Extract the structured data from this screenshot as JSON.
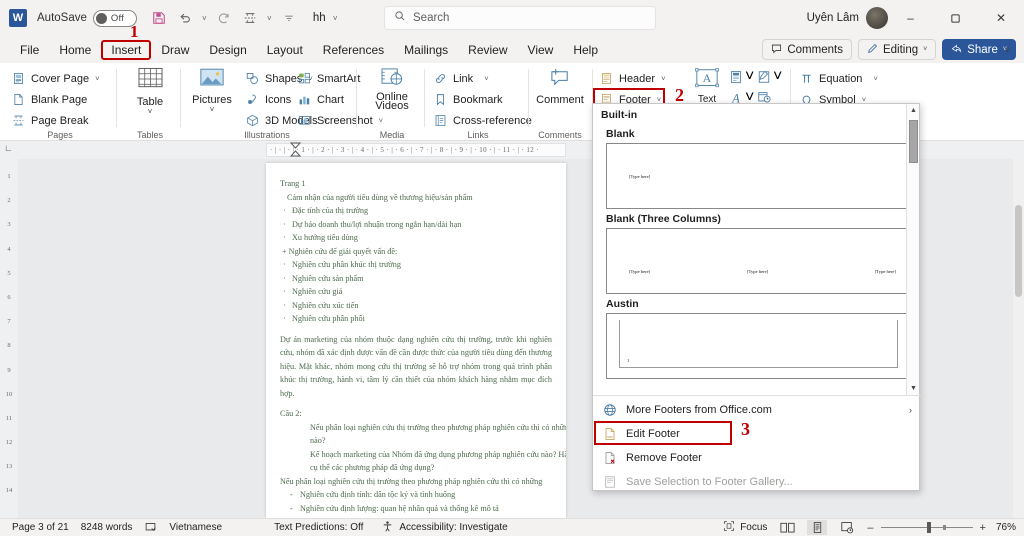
{
  "titlebar": {
    "app_logo": "word-logo",
    "autosave_label": "AutoSave",
    "autosave_state": "Off",
    "document_name": "hh",
    "user_name": "Uyên Lâm",
    "minimize": "–",
    "restore": "❐",
    "close": "✕"
  },
  "search": {
    "placeholder": "Search"
  },
  "tabs": [
    {
      "label": "File",
      "marked": false
    },
    {
      "label": "Home",
      "marked": false
    },
    {
      "label": "Insert",
      "marked": true
    },
    {
      "label": "Draw",
      "marked": false
    },
    {
      "label": "Design",
      "marked": false
    },
    {
      "label": "Layout",
      "marked": false
    },
    {
      "label": "References",
      "marked": false
    },
    {
      "label": "Mailings",
      "marked": false
    },
    {
      "label": "Review",
      "marked": false
    },
    {
      "label": "View",
      "marked": false
    },
    {
      "label": "Help",
      "marked": false
    }
  ],
  "tab_right": {
    "comments": "Comments",
    "editing": "Editing",
    "share": "Share"
  },
  "markers": {
    "one": "1",
    "two": "2",
    "three": "3",
    "color": "#c00000"
  },
  "ribbon": {
    "groups": [
      {
        "name": "Pages",
        "label": "Pages",
        "items": [
          {
            "label": "Cover Page",
            "icon": "cover-page-icon",
            "caret": true
          },
          {
            "label": "Blank Page",
            "icon": "blank-page-icon",
            "caret": false
          },
          {
            "label": "Page Break",
            "icon": "page-break-icon",
            "caret": false
          }
        ]
      },
      {
        "name": "Tables",
        "label": "Tables",
        "items": [
          {
            "label": "Table",
            "icon": "table-icon",
            "caret": true
          }
        ]
      },
      {
        "name": "Illustrations",
        "label": "Illustrations",
        "items": [
          {
            "label": "Pictures",
            "icon": "pictures-icon",
            "caret": true
          },
          {
            "label": "Shapes",
            "icon": "shapes-icon",
            "caret": true
          },
          {
            "label": "Icons",
            "icon": "icons-icon",
            "caret": false
          },
          {
            "label": "3D Models",
            "icon": "3d-models-icon",
            "caret": true
          },
          {
            "label": "SmartArt",
            "icon": "smartart-icon",
            "caret": false
          },
          {
            "label": "Chart",
            "icon": "chart-icon",
            "caret": false
          },
          {
            "label": "Screenshot",
            "icon": "screenshot-icon",
            "caret": true
          }
        ]
      },
      {
        "name": "Media",
        "label": "Media",
        "items": [
          {
            "label": "Online Videos",
            "icon": "online-videos-icon",
            "caret": false
          }
        ]
      },
      {
        "name": "Links",
        "label": "Links",
        "items": [
          {
            "label": "Link",
            "icon": "link-icon",
            "caret": true
          },
          {
            "label": "Bookmark",
            "icon": "bookmark-icon",
            "caret": false
          },
          {
            "label": "Cross-reference",
            "icon": "cross-reference-icon",
            "caret": false
          }
        ]
      },
      {
        "name": "Comments",
        "label": "Comments",
        "items": [
          {
            "label": "Comment",
            "icon": "comment-icon",
            "caret": false
          }
        ]
      },
      {
        "name": "HeaderFooter",
        "label": "",
        "items": [
          {
            "label": "Header",
            "icon": "header-icon",
            "caret": true
          },
          {
            "label": "Footer",
            "icon": "footer-icon",
            "caret": true
          }
        ]
      },
      {
        "name": "Text",
        "label": "",
        "items": [
          {
            "label": "Text",
            "icon": "text-box-icon",
            "caret": false
          }
        ]
      },
      {
        "name": "Symbols",
        "label": "",
        "items": [
          {
            "label": "Equation",
            "icon": "equation-icon",
            "caret": true
          },
          {
            "label": "Symbol",
            "icon": "symbol-icon",
            "caret": true
          }
        ]
      }
    ]
  },
  "footer_dropdown": {
    "category": "Built-in",
    "gallery": [
      {
        "name": "Blank",
        "type": "blank",
        "placeholders": [
          "[Type here]"
        ]
      },
      {
        "name": "Blank (Three Columns)",
        "type": "three-columns",
        "placeholders": [
          "[Type here]",
          "[Type here]",
          "[Type here]"
        ]
      },
      {
        "name": "Austin",
        "type": "austin",
        "placeholders": [
          "1"
        ]
      }
    ],
    "commands": [
      {
        "label": "More Footers from Office.com",
        "icon": "globe-icon",
        "accel": "M",
        "disabled": false,
        "submenu": true,
        "marked": false
      },
      {
        "label": "Edit Footer",
        "icon": "edit-footer-icon",
        "accel": "E",
        "disabled": false,
        "submenu": false,
        "marked": true
      },
      {
        "label": "Remove Footer",
        "icon": "remove-footer-icon",
        "accel": "R",
        "disabled": false,
        "submenu": false,
        "marked": false
      },
      {
        "label": "Save Selection to Footer Gallery...",
        "icon": "save-selection-icon",
        "accel": "S",
        "disabled": true,
        "submenu": false,
        "marked": false
      }
    ]
  },
  "ruler": {
    "horizontal_ticks": "· | · | ·    | · 1 · | · 2 · | · 3 · | · 4 · | · 5 · | · 6 · | · 7 · | · 8 · | · 9 · | · 10 · | · 11 · | · 12 ·",
    "vertical_ticks": [
      "1",
      "2",
      "3",
      "4",
      "5",
      "6",
      "7",
      "8",
      "9",
      "10",
      "11",
      "12",
      "13",
      "14"
    ]
  },
  "document": {
    "page_label": "Trang 1",
    "lines": [
      {
        "text": "Cảm nhận của người tiêu dùng về thương hiệu/sản phẩm",
        "style": "indent1"
      },
      {
        "text": "Đặc tính của thị trường",
        "style": "bullet"
      },
      {
        "text": "Dự báo doanh thu/lợi nhuận trong ngắn hạn/dài hạn",
        "style": "bullet"
      },
      {
        "text": "Xu hướng tiêu dùng",
        "style": "bullet"
      },
      {
        "text": "+ Nghiên cứu để giải quyết vấn đề:",
        "style": "plus"
      },
      {
        "text": "Nghiên cứu phân khúc thị trường",
        "style": "bullet"
      },
      {
        "text": "Nghiên cứu sản phẩm",
        "style": "bullet"
      },
      {
        "text": "Nghiên cứu giá",
        "style": "bullet"
      },
      {
        "text": "Nghiên cứu xúc tiến",
        "style": "bullet"
      },
      {
        "text": "Nghiên cứu phân phối",
        "style": "bullet"
      }
    ],
    "paragraph": "Dự án marketing của nhóm thuộc dạng nghiên cứu thị trường, trước khi nghiên cứu, nhóm đã xác định được vấn đề cần được thức của người tiêu dùng đến thương hiệu. Mặt khác, nhóm mong cứu thị trường sẽ hỗ trợ nhóm trong quá trình phân khúc thị trường, hành vi, tâm lý cần thiết của nhóm khách hàng nhằm mục đích hợp.",
    "question_heading": "Câu 2:",
    "question_lines": [
      {
        "text": "Nếu phân loại nghiên cứu thị trường theo phương pháp nghiên cứu thì có những phương pháp",
        "style": "ind2"
      },
      {
        "text": "nào?",
        "style": "ind2"
      },
      {
        "text": "Kế hoạch marketing của Nhóm đã ứng dụng phương pháp nghiên cứu nào? Hãy nêu",
        "style": "ind2"
      },
      {
        "text": "cụ thể các phương pháp đã ứng dụng?",
        "style": "ind2"
      },
      {
        "text": "Nếu phân loại nghiên cứu thị trường theo phương pháp nghiên cứu thì có những",
        "style": "none"
      },
      {
        "text": "Nghiên cứu định tính: dân tộc ký và tình huống",
        "style": "dash"
      },
      {
        "text": "Nghiên cứu định lượng: quan hệ nhân quả và thống kê mô tả",
        "style": "dash"
      }
    ]
  },
  "status": {
    "page": "Page 3 of 21",
    "words": "8248 words",
    "proofing_icon": "spell-check-icon",
    "language": "Vietnamese",
    "text_predictions": "Text Predictions: Off",
    "accessibility": "Accessibility: Investigate",
    "focus": "Focus",
    "views": [
      "read-mode-icon",
      "print-layout-icon",
      "web-layout-icon"
    ],
    "zoom_out": "–",
    "zoom_in": "+",
    "zoom_level": "76%"
  }
}
